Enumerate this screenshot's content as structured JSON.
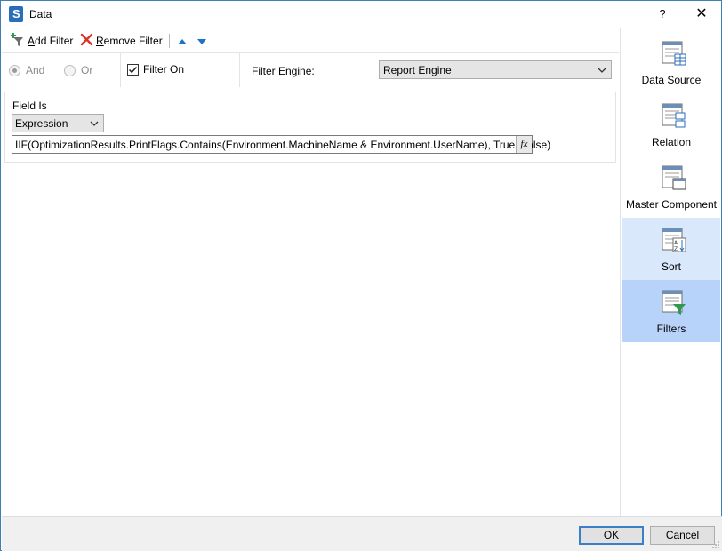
{
  "window": {
    "title": "Data",
    "help_label": "?",
    "close_label": "✕"
  },
  "toolbar": {
    "add_filter_label": "Add Filter",
    "remove_filter_label": "Remove Filter"
  },
  "options": {
    "and_label": "And",
    "or_label": "Or",
    "logic_selected": "And",
    "filter_on_label": "Filter On",
    "filter_on_checked": true,
    "filter_engine_label": "Filter Engine:",
    "filter_engine_value": "Report Engine"
  },
  "filter": {
    "field_is_label": "Field Is",
    "field_is_value": "Expression",
    "expression_value": "IIF(OptimizationResults.PrintFlags.Contains(Environment.MachineName & Environment.UserName), True, False)",
    "fx_label": "fx"
  },
  "nav": {
    "items": [
      {
        "label": "Data Source",
        "icon": "data-source-icon",
        "state": "normal"
      },
      {
        "label": "Relation",
        "icon": "relation-icon",
        "state": "normal"
      },
      {
        "label": "Master Component",
        "icon": "master-component-icon",
        "state": "normal"
      },
      {
        "label": "Sort",
        "icon": "sort-icon",
        "state": "hover"
      },
      {
        "label": "Filters",
        "icon": "filters-icon",
        "state": "selected"
      }
    ]
  },
  "footer": {
    "ok_label": "OK",
    "cancel_label": "Cancel"
  },
  "colors": {
    "accent": "#2a6ebb",
    "nav_selected": "#b7d3f9",
    "nav_hover": "#dae8fb",
    "remove_red": "#d9342b",
    "arrow_blue": "#1f73c6",
    "filter_green": "#2e9a4f"
  }
}
